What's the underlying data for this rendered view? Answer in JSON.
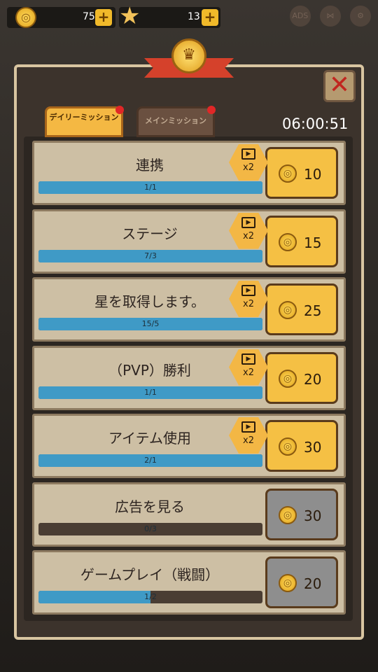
{
  "resources": {
    "coins": "75",
    "stars": "13"
  },
  "top_icons": {
    "ads": "ADS"
  },
  "tabs": {
    "daily": "デイリーミッション",
    "main": "メインミッション"
  },
  "timer": "06:00:51",
  "ad_badge": "x2",
  "missions": [
    {
      "title": "連携",
      "progress": "1/1",
      "fraction": 1.0,
      "reward": "10",
      "has_ad": true,
      "state": "gold"
    },
    {
      "title": "ステージ",
      "progress": "7/3",
      "fraction": 1.0,
      "reward": "15",
      "has_ad": true,
      "state": "gold"
    },
    {
      "title": "星を取得します。",
      "progress": "15/5",
      "fraction": 1.0,
      "reward": "25",
      "has_ad": true,
      "state": "gold"
    },
    {
      "title": "（PVP）勝利",
      "progress": "1/1",
      "fraction": 1.0,
      "reward": "20",
      "has_ad": true,
      "state": "gold"
    },
    {
      "title": "アイテム使用",
      "progress": "2/1",
      "fraction": 1.0,
      "reward": "30",
      "has_ad": true,
      "state": "gold"
    },
    {
      "title": "広告を見る",
      "progress": "0/3",
      "fraction": 0.0,
      "reward": "30",
      "has_ad": false,
      "state": "gray"
    },
    {
      "title": "ゲームプレイ（戦闘）",
      "progress": "1/2",
      "fraction": 0.5,
      "reward": "20",
      "has_ad": false,
      "state": "gray"
    }
  ],
  "colors": {
    "accent": "#f5c044",
    "progress": "#3f9ac6",
    "close": "#c1261f"
  }
}
